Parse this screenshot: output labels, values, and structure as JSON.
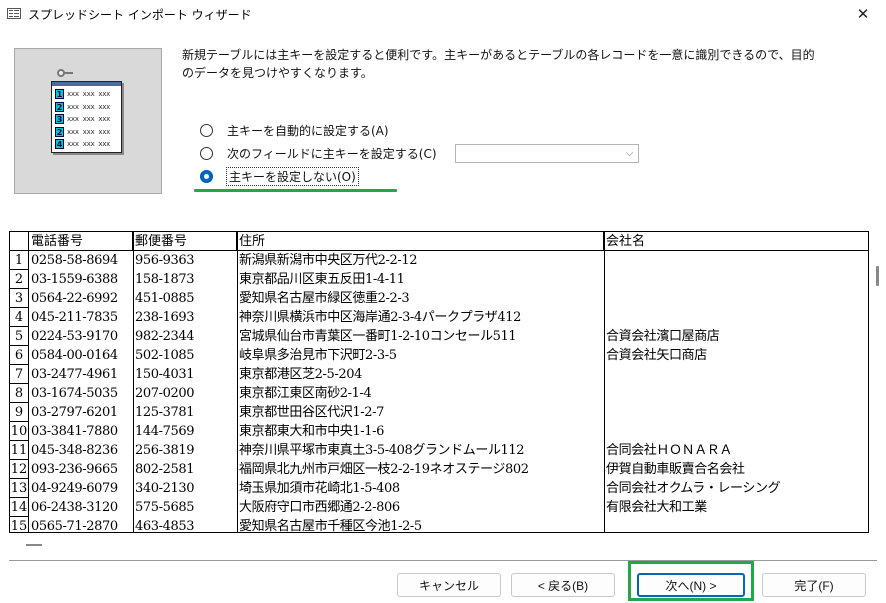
{
  "window": {
    "title": "スプレッドシート インポート ウィザード",
    "close_glyph": "✕"
  },
  "illustration": {
    "rows": [
      {
        "num": "1",
        "text": "xxx xxx xxx"
      },
      {
        "num": "2",
        "text": "xxx xxx xxx"
      },
      {
        "num": "3",
        "text": "xxx xxx xxx"
      },
      {
        "num": "2",
        "text": "xxx xxx xxx"
      },
      {
        "num": "4",
        "text": "xxx xxx xxx"
      }
    ]
  },
  "description": "新規テーブルには主キーを設定すると便利です。主キーがあるとテーブルの各レコードを一意に識別できるので、目的のデータを見つけやすくなります。",
  "options": {
    "auto": "主キーを自動的に設定する(A)",
    "choose": "次のフィールドに主キーを設定する(C)",
    "none": "主キーを設定しない(O)",
    "selected": "none",
    "field_value": ""
  },
  "grid": {
    "columns": [
      "電話番号",
      "郵便番号",
      "住所",
      "会社名"
    ],
    "rows": [
      {
        "n": "1",
        "phone": "0258-58-8694",
        "zip": "956-9363",
        "addr": "新潟県新潟市中央区万代2-2-12",
        "company": ""
      },
      {
        "n": "2",
        "phone": "03-1559-6388",
        "zip": "158-1873",
        "addr": "東京都品川区東五反田1-4-11",
        "company": ""
      },
      {
        "n": "3",
        "phone": "0564-22-6992",
        "zip": "451-0885",
        "addr": "愛知県名古屋市緑区徳重2-2-3",
        "company": ""
      },
      {
        "n": "4",
        "phone": "045-211-7835",
        "zip": "238-1693",
        "addr": "神奈川県横浜市中区海岸通2-3-4パークプラザ412",
        "company": ""
      },
      {
        "n": "5",
        "phone": "0224-53-9170",
        "zip": "982-2344",
        "addr": "宮城県仙台市青葉区一番町1-2-10コンセール511",
        "company": "合資会社濱口屋商店"
      },
      {
        "n": "6",
        "phone": "0584-00-0164",
        "zip": "502-1085",
        "addr": "岐阜県多治見市下沢町2-3-5",
        "company": "合資会社矢口商店"
      },
      {
        "n": "7",
        "phone": "03-2477-4961",
        "zip": "150-4031",
        "addr": "東京都港区芝2-5-204",
        "company": ""
      },
      {
        "n": "8",
        "phone": "03-1674-5035",
        "zip": "207-0200",
        "addr": "東京都江東区南砂2-1-4",
        "company": ""
      },
      {
        "n": "9",
        "phone": "03-2797-6201",
        "zip": "125-3781",
        "addr": "東京都世田谷区代沢1-2-7",
        "company": ""
      },
      {
        "n": "10",
        "phone": "03-3841-7880",
        "zip": "144-7569",
        "addr": "東京都東大和市中央1-1-6",
        "company": ""
      },
      {
        "n": "11",
        "phone": "045-348-8236",
        "zip": "256-3819",
        "addr": "神奈川県平塚市東真土3-5-408グランドムール112",
        "company": "合同会社ＨＯＮＡＲＡ"
      },
      {
        "n": "12",
        "phone": "093-236-9665",
        "zip": "802-2581",
        "addr": "福岡県北九州市戸畑区一枝2-2-19ネオステージ802",
        "company": "伊賀自動車販賣合名会社"
      },
      {
        "n": "13",
        "phone": "04-9249-6079",
        "zip": "340-2130",
        "addr": "埼玉県加須市花崎北1-5-408",
        "company": "合同会社オクムラ・レーシング"
      },
      {
        "n": "14",
        "phone": "06-2438-3120",
        "zip": "575-5685",
        "addr": "大阪府守口市西郷通2-2-806",
        "company": "有限会社大和工業"
      },
      {
        "n": "15",
        "phone": "0565-71-2870",
        "zip": "463-4853",
        "addr": "愛知県名古屋市千種区今池1-2-5",
        "company": ""
      }
    ]
  },
  "buttons": {
    "cancel": "キャンセル",
    "back": "< 戻る(B)",
    "next": "次へ(N) >",
    "finish": "完了(F)"
  }
}
